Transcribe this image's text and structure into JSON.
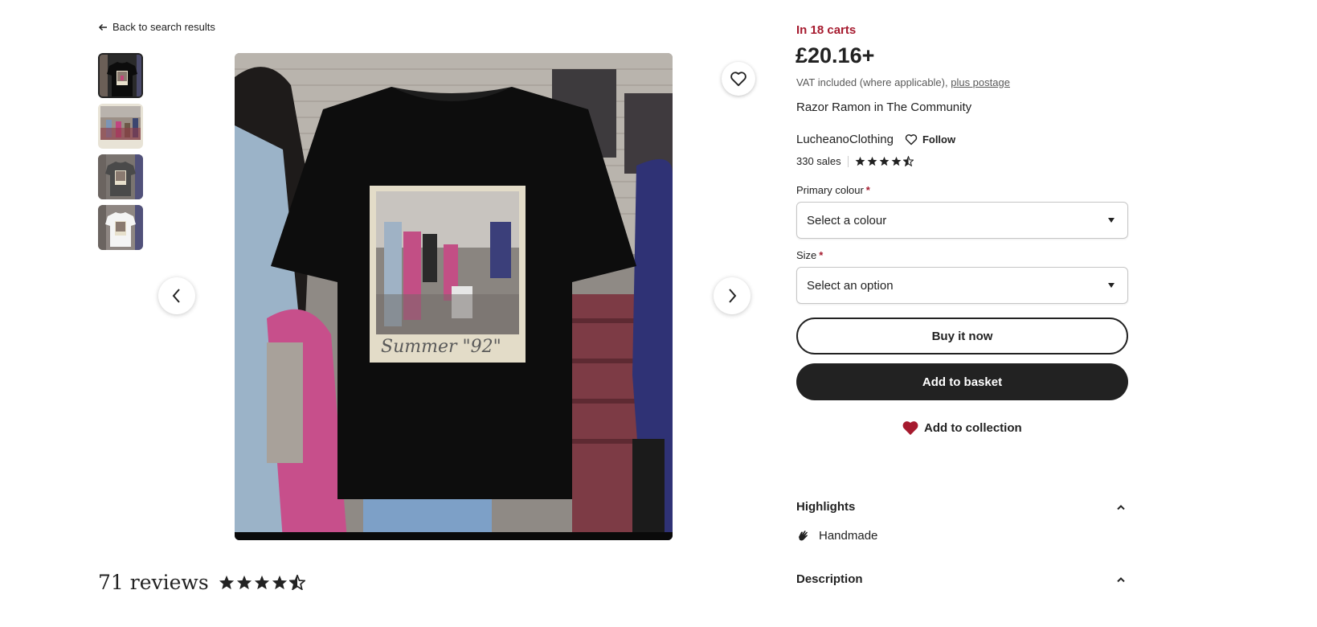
{
  "nav": {
    "back_label": "Back to search results"
  },
  "gallery": {
    "thumbnails": [
      {
        "alt": "black t-shirt",
        "active": true
      },
      {
        "alt": "product photo",
        "active": false
      },
      {
        "alt": "grey t-shirt",
        "active": false
      },
      {
        "alt": "white t-shirt",
        "active": false
      }
    ],
    "print_caption": "Summer \"92\""
  },
  "listing": {
    "in_carts": "In 18 carts",
    "price": "£20.16+",
    "vat_text": "VAT included (where applicable), ",
    "postage_link": "plus postage",
    "title": "Razor Ramon in The Community",
    "shop_name": "LucheanoClothing",
    "follow_label": "Follow",
    "sales": "330 sales",
    "shop_rating": 4.5
  },
  "options": {
    "colour_label": "Primary colour",
    "colour_placeholder": "Select a colour",
    "size_label": "Size",
    "size_placeholder": "Select an option",
    "required_mark": "*"
  },
  "actions": {
    "buy_now": "Buy it now",
    "add_to_basket": "Add to basket",
    "add_to_collection": "Add to collection"
  },
  "sections": {
    "highlights": "Highlights",
    "handmade": "Handmade",
    "description": "Description"
  },
  "reviews": {
    "title": "71 reviews",
    "rating": 4.5
  },
  "colors": {
    "accent": "#a61a2e",
    "dark": "#222222"
  }
}
